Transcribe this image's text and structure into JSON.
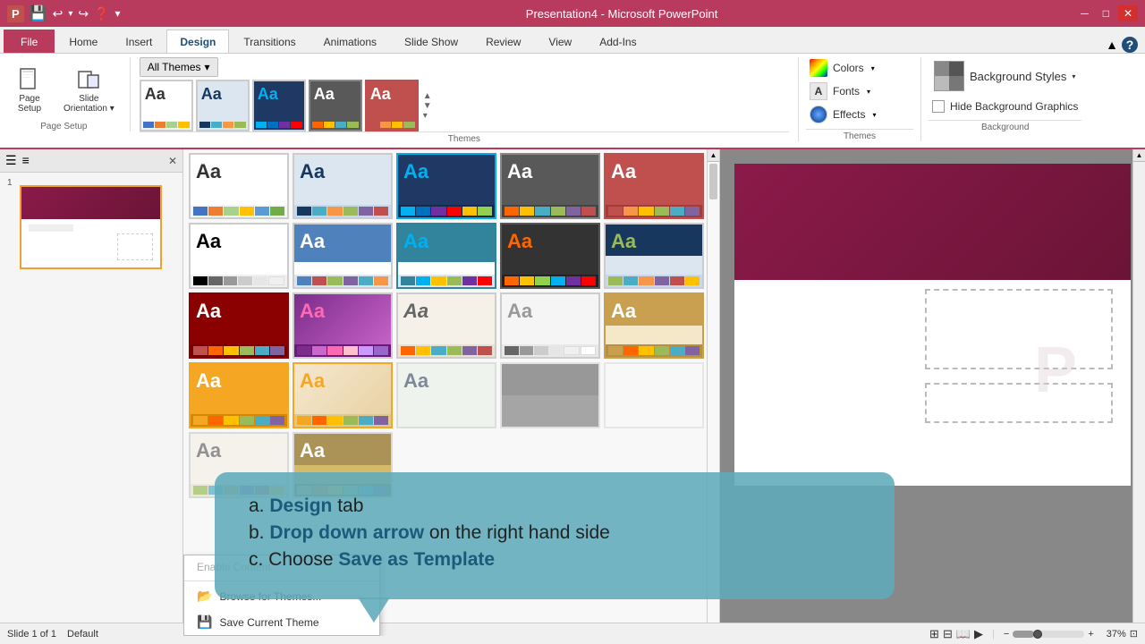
{
  "titleBar": {
    "title": "Presentation4 - Microsoft PowerPoint",
    "controls": [
      "─",
      "□",
      "✕"
    ]
  },
  "ribbon": {
    "tabs": [
      "File",
      "Home",
      "Insert",
      "Design",
      "Transitions",
      "Animations",
      "Slide Show",
      "Review",
      "View",
      "Add-Ins"
    ],
    "activeTab": "Design",
    "pageSetup": {
      "label": "Page Setup",
      "buttons": [
        {
          "icon": "📄",
          "label": "Page\nSetup"
        },
        {
          "icon": "🔄",
          "label": "Slide\nOrientation"
        }
      ]
    },
    "themesDropdown": "All Themes",
    "rightPanel": {
      "colors": "Colors",
      "fonts": "Fonts",
      "effects": "Effects",
      "backgroundStyles": "Background Styles",
      "hideBackground": "Hide Background Graphics",
      "groupLabel": "Background"
    }
  },
  "themes": [
    {
      "label": "Aa",
      "bg": "#ffffff",
      "textColor": "#333333",
      "dots": [
        "#4472c4",
        "#ed7d31",
        "#a9d18e",
        "#ffc000",
        "#5b9bd5",
        "#70ad47"
      ]
    },
    {
      "label": "Aa",
      "bg": "#dce6f1",
      "textColor": "#17375e",
      "dots": [
        "#17375e",
        "#4bacc6",
        "#f79646",
        "#9bbb59",
        "#8064a2",
        "#c0504d"
      ]
    },
    {
      "label": "Aa",
      "bg": "#1f3864",
      "textColor": "#00b0f0",
      "dots": [
        "#00b0f0",
        "#0070c0",
        "#7030a0",
        "#ff0000",
        "#ffc000",
        "#92d050"
      ]
    },
    {
      "label": "Aa",
      "bg": "#595959",
      "textColor": "#ffffff",
      "dots": [
        "#ff6600",
        "#ffc000",
        "#4bacc6",
        "#9bbb59",
        "#8064a2",
        "#c0504d"
      ]
    },
    {
      "label": "Aa",
      "bg": "#c0504d",
      "textColor": "#ffffff",
      "dots": [
        "#c0504d",
        "#f79646",
        "#ffc000",
        "#9bbb59",
        "#4bacc6",
        "#8064a2"
      ]
    },
    {
      "label": "Aa",
      "bg": "#ffffff",
      "textColor": "#000000",
      "dots": [
        "#000000",
        "#666666",
        "#999999",
        "#cccccc",
        "#e6e6e6",
        "#f0f0f0"
      ]
    },
    {
      "label": "Aa",
      "bg": "#4f81bd",
      "textColor": "#ffffff",
      "dots": [
        "#4f81bd",
        "#c0504d",
        "#9bbb59",
        "#8064a2",
        "#4bacc6",
        "#f79646"
      ]
    },
    {
      "label": "Aa",
      "bg": "#31849b",
      "textColor": "#00b0f0",
      "dots": [
        "#31849b",
        "#00b0f0",
        "#ffc000",
        "#9bbb59",
        "#7030a0",
        "#ff0000"
      ]
    },
    {
      "label": "Aa",
      "bg": "#333333",
      "textColor": "#ff6600",
      "dots": [
        "#ff6600",
        "#ffc000",
        "#92d050",
        "#00b0f0",
        "#7030a0",
        "#ff0000"
      ]
    },
    {
      "label": "Aa",
      "bg": "#17375e",
      "textColor": "#9bbb59",
      "dots": [
        "#9bbb59",
        "#4bacc6",
        "#f79646",
        "#8064a2",
        "#c0504d",
        "#ffc000"
      ]
    },
    {
      "label": "Aa",
      "bg": "#8b0000",
      "textColor": "#ffffff",
      "dots": [
        "#c0504d",
        "#ff6600",
        "#ffc000",
        "#9bbb59",
        "#4bacc6",
        "#8064a2"
      ]
    },
    {
      "label": "Aa",
      "bg": "#7b2d8b",
      "textColor": "#ff69b4",
      "dots": [
        "#7b2d8b",
        "#cc66cc",
        "#ff69b4",
        "#ffc0cb",
        "#cc99ff",
        "#9966cc"
      ]
    },
    {
      "label": "Aa",
      "bg": "#f0f0f0",
      "textColor": "#333333",
      "dots": [
        "#ff6600",
        "#ffc000",
        "#4bacc6",
        "#9bbb59",
        "#8064a2",
        "#c0504d"
      ]
    },
    {
      "label": "Aa",
      "bg": "#f5f5f5",
      "textColor": "#666666",
      "dots": [
        "#666666",
        "#999999",
        "#cccccc",
        "#e6e6e6",
        "#f0f0f0",
        "#ffffff"
      ]
    },
    {
      "label": "Aa",
      "bg": "#c8a050",
      "textColor": "#ffffff",
      "dots": [
        "#c8a050",
        "#ff6600",
        "#ffc000",
        "#9bbb59",
        "#4bacc6",
        "#8064a2"
      ]
    },
    {
      "label": "Aa",
      "bg": "#f5a623",
      "textColor": "#ffffff",
      "dots": [
        "#f5a623",
        "#ff6600",
        "#ffc000",
        "#9bbb59",
        "#4bacc6",
        "#8064a2"
      ]
    },
    {
      "label": "Aa",
      "bg": "#f0f0f0",
      "textColor": "#f5a623",
      "dots": [
        "#f5a623",
        "#ff6600",
        "#ffc000",
        "#9bbb59",
        "#4bacc6",
        "#8064a2"
      ]
    },
    {
      "label": "Aa",
      "bg": "#2e4057",
      "textColor": "#ffffff",
      "dots": [
        "#2e4057",
        "#4bacc6",
        "#f79646",
        "#9bbb59",
        "#8064a2",
        "#c0504d"
      ]
    }
  ],
  "dropdown": {
    "items": [
      {
        "label": "Enable Content",
        "disabled": true
      },
      {
        "label": "Browse for Themes...",
        "icon": "📂"
      },
      {
        "label": "Save Current Theme",
        "icon": "💾"
      }
    ]
  },
  "tooltip": {
    "lines": [
      {
        "prefix": "a. ",
        "bold": "Design",
        "suffix": " tab"
      },
      {
        "prefix": "b. ",
        "bold": "Drop down arrow",
        "suffix": " on the right hand side"
      },
      {
        "prefix": "c. ",
        "suffix": "Choose ",
        "bold2": "Save as Template"
      }
    ]
  },
  "statusBar": {
    "slideInfo": "Slide 1 of 1",
    "theme": "Default",
    "zoom": "37%"
  }
}
